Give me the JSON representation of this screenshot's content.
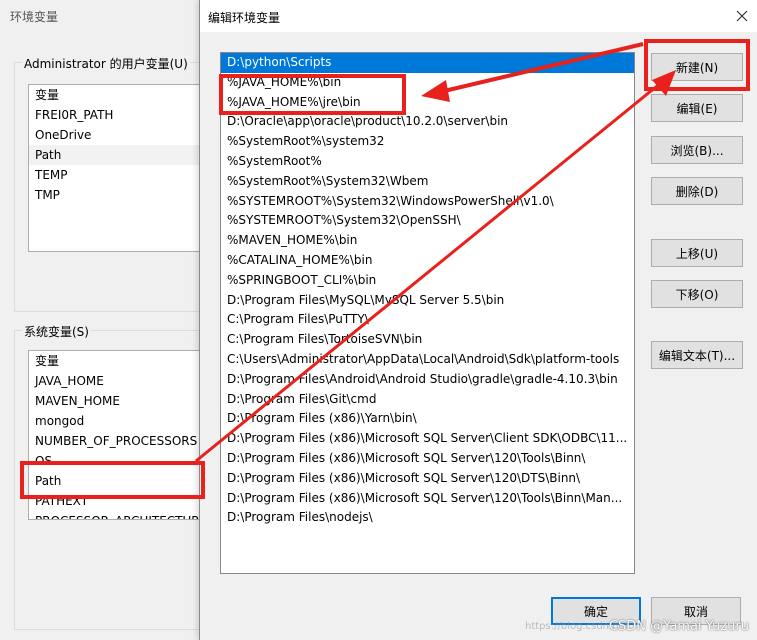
{
  "background_window": {
    "title": "环境变量",
    "user_vars_label": "Administrator 的用户变量(U)",
    "user_vars": [
      "变量",
      "FREI0R_PATH",
      "OneDrive",
      "Path",
      "TEMP",
      "TMP"
    ],
    "system_vars_label": "系统变量(S)",
    "system_vars": [
      "变量",
      "JAVA_HOME",
      "MAVEN_HOME",
      "mongod",
      "NUMBER_OF_PROCESSORS",
      "OS",
      "Path",
      "PATHEXT",
      "PROCESSOR_ARCHITECTURE"
    ]
  },
  "dialog": {
    "title": "编辑环境变量",
    "paths": [
      "D:\\python\\Scripts",
      "%JAVA_HOME%\\bin",
      "%JAVA_HOME%\\jre\\bin",
      "D:\\Oracle\\app\\oracle\\product\\10.2.0\\server\\bin",
      "%SystemRoot%\\system32",
      "%SystemRoot%",
      "%SystemRoot%\\System32\\Wbem",
      "%SYSTEMROOT%\\System32\\WindowsPowerShell\\v1.0\\",
      "%SYSTEMROOT%\\System32\\OpenSSH\\",
      "%MAVEN_HOME%\\bin",
      "%CATALINA_HOME%\\bin",
      "%SPRINGBOOT_CLI%\\bin",
      "D:\\Program Files\\MySQL\\MySQL Server 5.5\\bin",
      "C:\\Program Files\\PuTTY\\",
      "C:\\Program Files\\TortoiseSVN\\bin",
      "C:\\Users\\Administrator\\AppData\\Local\\Android\\Sdk\\platform-tools",
      "D:\\Program Files\\Android\\Android Studio\\gradle\\gradle-4.10.3\\bin",
      "D:\\Program Files\\Git\\cmd",
      "D:\\Program Files (x86)\\Yarn\\bin\\",
      "D:\\Program Files (x86)\\Microsoft SQL Server\\Client SDK\\ODBC\\11...",
      "D:\\Program Files (x86)\\Microsoft SQL Server\\120\\Tools\\Binn\\",
      "D:\\Program Files (x86)\\Microsoft SQL Server\\120\\DTS\\Binn\\",
      "D:\\Program Files (x86)\\Microsoft SQL Server\\120\\Tools\\Binn\\Man...",
      "D:\\Program Files\\nodejs\\"
    ],
    "selected_index": 0,
    "buttons": {
      "new": "新建(N)",
      "edit": "编辑(E)",
      "browse": "浏览(B)...",
      "delete": "删除(D)",
      "move_up": "上移(U)",
      "move_down": "下移(O)",
      "edit_text": "编辑文本(T)..."
    },
    "ok": "确定",
    "cancel": "取消"
  },
  "annotation_color": "#e8211c",
  "watermark": "CSDN @Yamai Yuzuru",
  "watermark_faint": "https://blog.csdn.net"
}
